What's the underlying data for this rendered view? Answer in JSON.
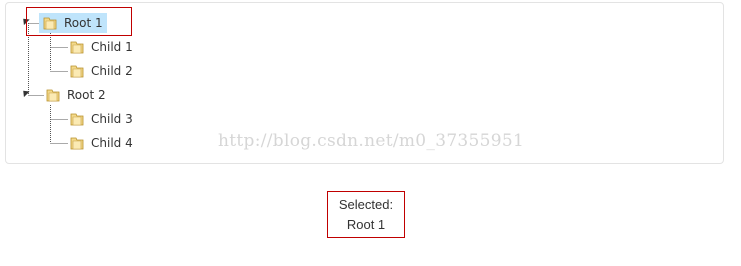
{
  "tree": {
    "nodes": [
      {
        "label": "Root 1",
        "children": [
          {
            "label": "Child 1"
          },
          {
            "label": "Child 2"
          }
        ]
      },
      {
        "label": "Root 2",
        "children": [
          {
            "label": "Child 3"
          },
          {
            "label": "Child 4"
          }
        ]
      }
    ]
  },
  "watermark": "http://blog.csdn.net/m0_37355951",
  "selection": {
    "heading": "Selected:",
    "value": "Root 1"
  },
  "colors": {
    "selected_bg": "#bfe4fb",
    "highlight_border": "#c00000",
    "folder": "#e8c46a"
  }
}
